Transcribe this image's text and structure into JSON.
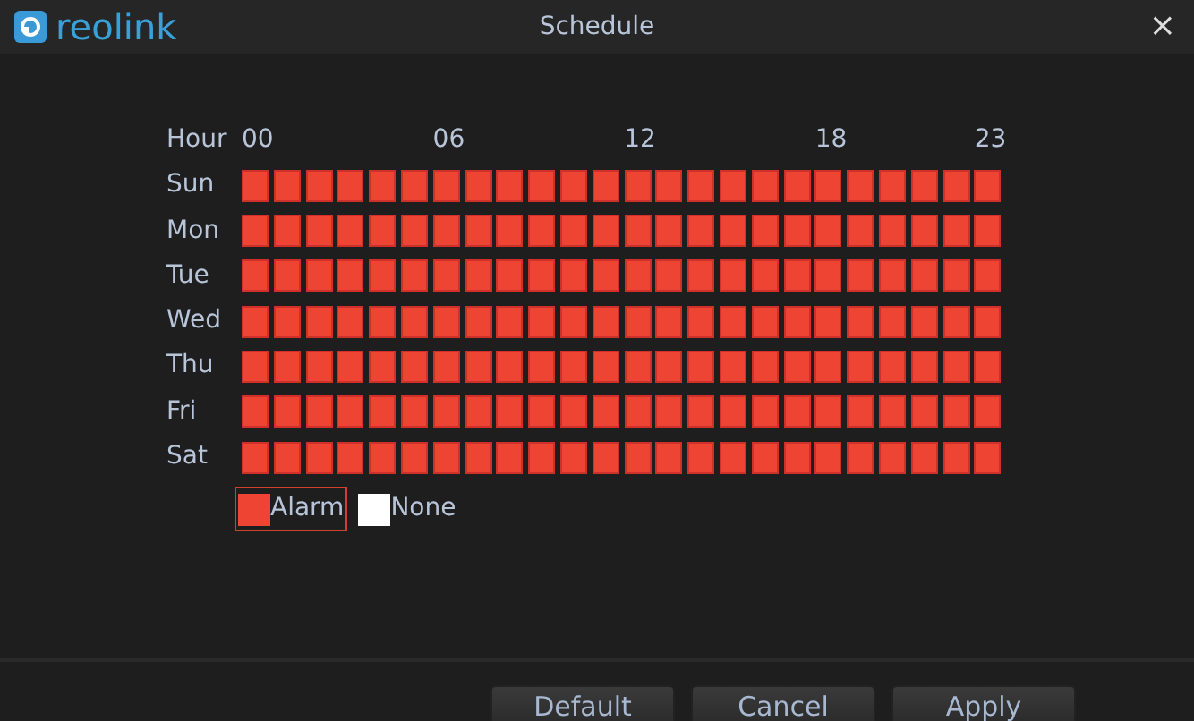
{
  "logo": {
    "text": "reolink"
  },
  "window": {
    "title": "Schedule",
    "close": "×"
  },
  "hour_header": {
    "label": "Hour",
    "ticks": [
      "00",
      "06",
      "12",
      "18",
      "23"
    ]
  },
  "days": [
    {
      "label": "Sun",
      "slots": [
        true,
        true,
        true,
        true,
        true,
        true,
        true,
        true,
        true,
        true,
        true,
        true,
        true,
        true,
        true,
        true,
        true,
        true,
        true,
        true,
        true,
        true,
        true,
        true
      ]
    },
    {
      "label": "Mon",
      "slots": [
        true,
        true,
        true,
        true,
        true,
        true,
        true,
        true,
        true,
        true,
        true,
        true,
        true,
        true,
        true,
        true,
        true,
        true,
        true,
        true,
        true,
        true,
        true,
        true
      ]
    },
    {
      "label": "Tue",
      "slots": [
        true,
        true,
        true,
        true,
        true,
        true,
        true,
        true,
        true,
        true,
        true,
        true,
        true,
        true,
        true,
        true,
        true,
        true,
        true,
        true,
        true,
        true,
        true,
        true
      ]
    },
    {
      "label": "Wed",
      "slots": [
        true,
        true,
        true,
        true,
        true,
        true,
        true,
        true,
        true,
        true,
        true,
        true,
        true,
        true,
        true,
        true,
        true,
        true,
        true,
        true,
        true,
        true,
        true,
        true
      ]
    },
    {
      "label": "Thu",
      "slots": [
        true,
        true,
        true,
        true,
        true,
        true,
        true,
        true,
        true,
        true,
        true,
        true,
        true,
        true,
        true,
        true,
        true,
        true,
        true,
        true,
        true,
        true,
        true,
        true
      ]
    },
    {
      "label": "Fri",
      "slots": [
        true,
        true,
        true,
        true,
        true,
        true,
        true,
        true,
        true,
        true,
        true,
        true,
        true,
        true,
        true,
        true,
        true,
        true,
        true,
        true,
        true,
        true,
        true,
        true
      ]
    },
    {
      "label": "Sat",
      "slots": [
        true,
        true,
        true,
        true,
        true,
        true,
        true,
        true,
        true,
        true,
        true,
        true,
        true,
        true,
        true,
        true,
        true,
        true,
        true,
        true,
        true,
        true,
        true,
        true
      ]
    }
  ],
  "legend": [
    {
      "label": "Alarm",
      "color": "#ee4433",
      "selected": true
    },
    {
      "label": "None",
      "color": "#ffffff",
      "selected": false
    }
  ],
  "buttons": [
    "Default",
    "Cancel",
    "Apply"
  ]
}
